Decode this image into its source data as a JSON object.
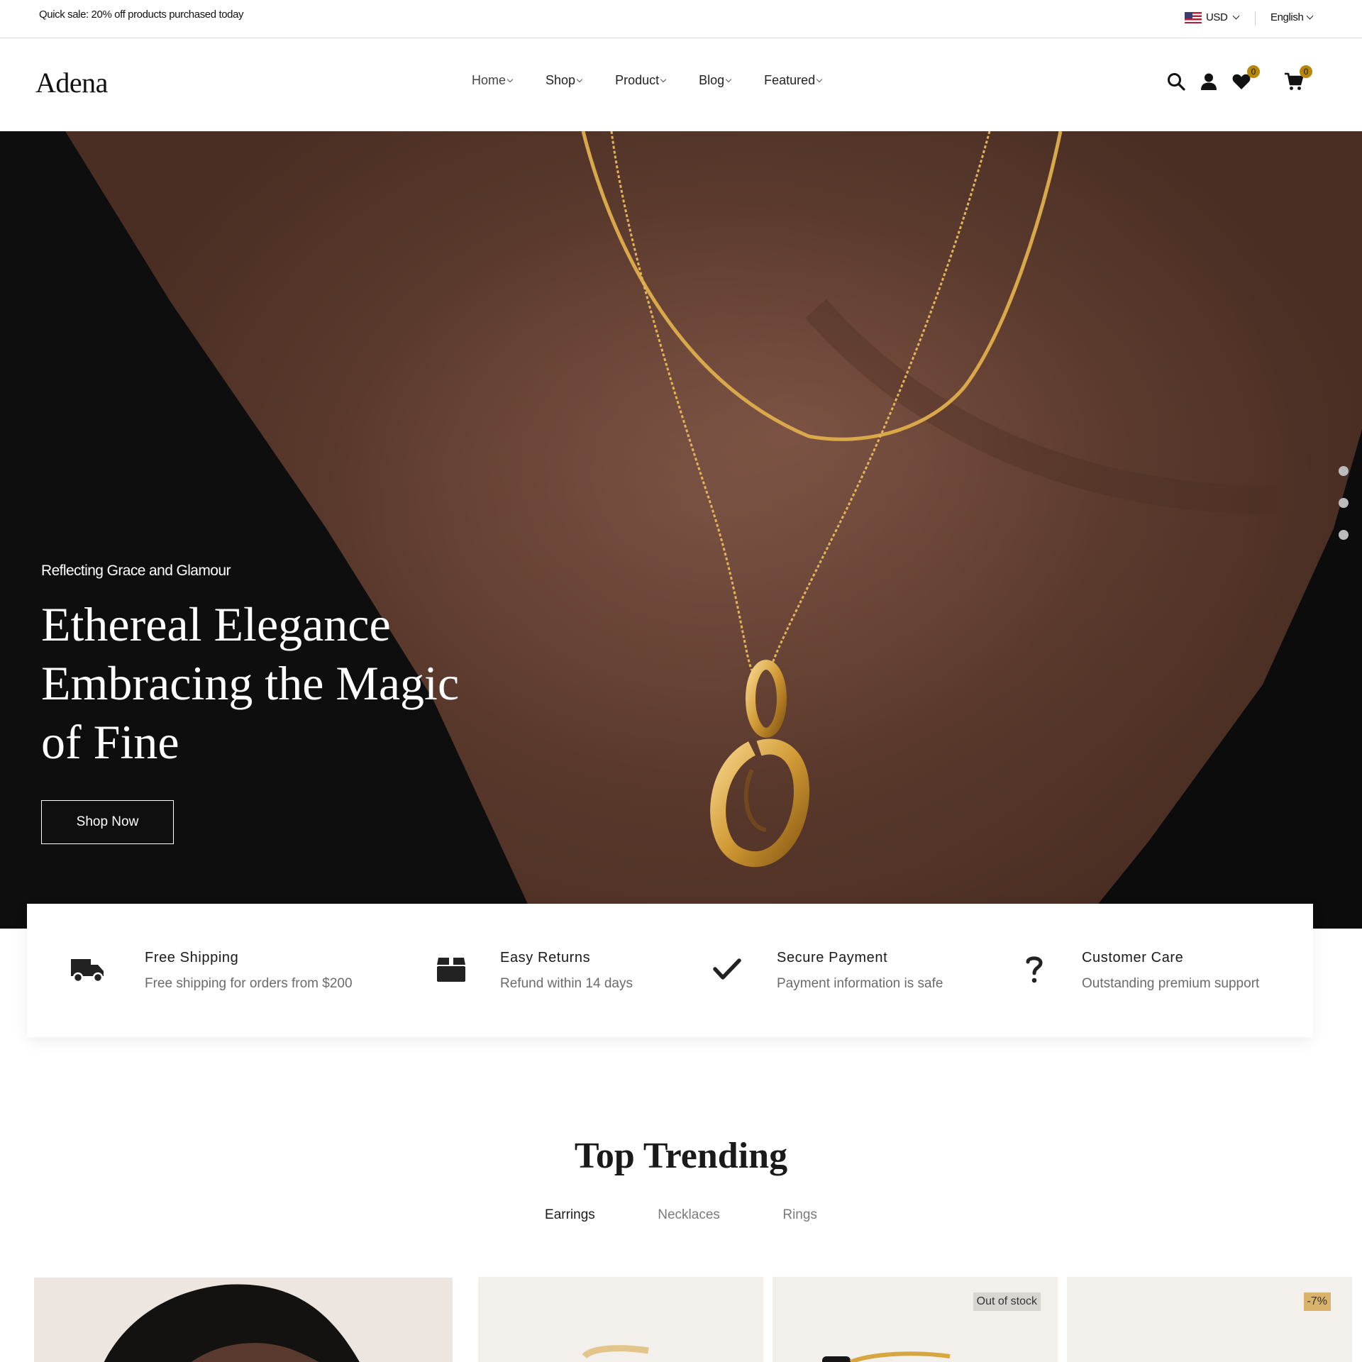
{
  "topbar": {
    "promo": "Quick sale: 20% off products purchased today",
    "currency": "USD",
    "language": "English"
  },
  "header": {
    "logo": "Adena",
    "nav": [
      "Home",
      "Shop",
      "Product",
      "Blog",
      "Featured"
    ],
    "wishlist_count": "0",
    "cart_count": "0"
  },
  "hero": {
    "subtitle": "Reflecting Grace and Glamour",
    "title": "Ethereal Elegance Embracing the Magic of Fine",
    "button": "Shop Now",
    "slide_count": 3
  },
  "features": [
    {
      "icon": "truck-icon",
      "title": "Free Shipping",
      "desc": "Free shipping for orders from $200"
    },
    {
      "icon": "box-icon",
      "title": "Easy Returns",
      "desc": "Refund within 14 days"
    },
    {
      "icon": "check-icon",
      "title": "Secure Payment",
      "desc": "Payment information is safe"
    },
    {
      "icon": "question-icon",
      "title": "Customer Care",
      "desc": "Outstanding premium support"
    }
  ],
  "trending": {
    "title": "Top Trending",
    "tabs": [
      "Earrings",
      "Necklaces",
      "Rings"
    ],
    "active_tab": "Earrings",
    "badges": [
      "Out of stock",
      "-7%"
    ]
  },
  "colors": {
    "accent": "#b8860b",
    "dress": "#0f0f0f",
    "skin": "#6a4536",
    "gold": "#d8a640"
  }
}
